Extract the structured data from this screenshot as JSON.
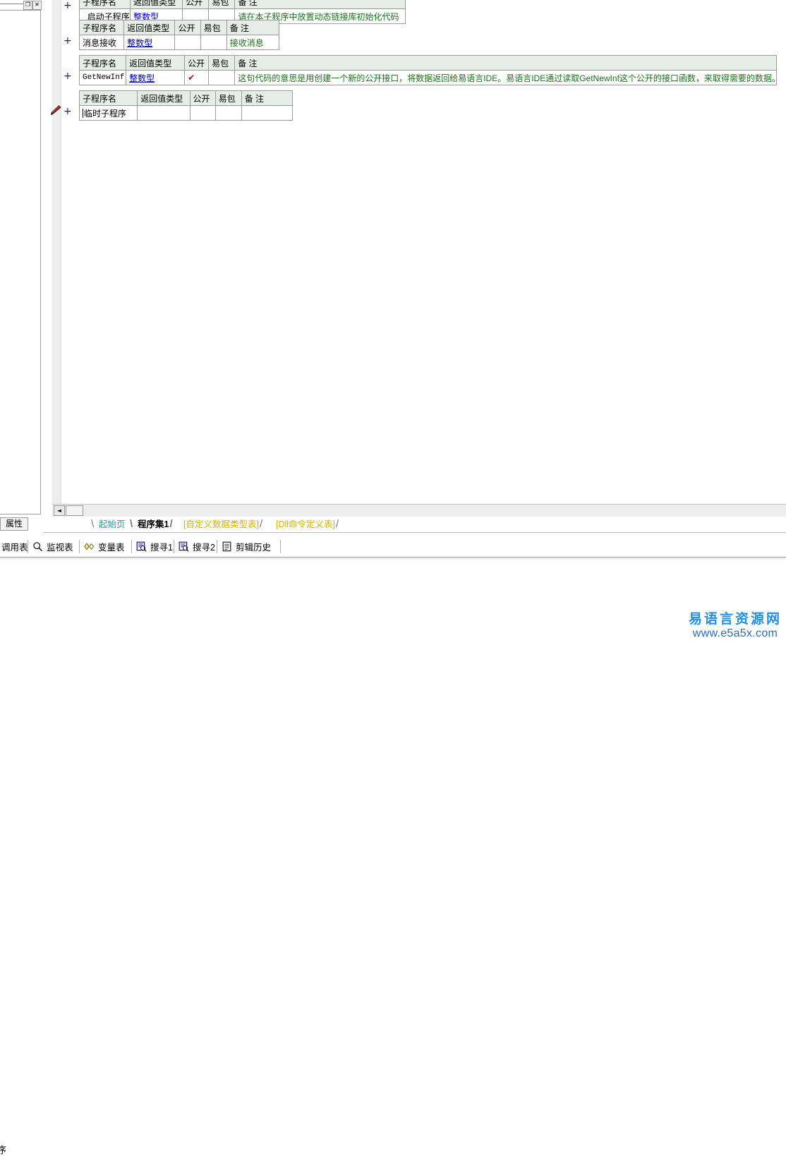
{
  "app": {
    "property_panel": {
      "tab_label": "属性",
      "maximize_glyph": "❐",
      "close_glyph": "✕"
    }
  },
  "editor": {
    "gutter": {
      "expand_glyph": "+",
      "rows_with_expander": 4,
      "pencil_icon": "pencil-icon"
    },
    "columns": [
      "子程序名",
      "返回值类型",
      "公开",
      "易包",
      "备 注"
    ],
    "tables": [
      {
        "id": "routine-table-start",
        "header_visible": false,
        "row": {
          "name": "_启动子程序",
          "return_type": "整数型",
          "public": "",
          "package": "",
          "note": "请在本子程序中放置动态链接库初始化代码"
        }
      },
      {
        "id": "routine-table-message",
        "header_visible": true,
        "row": {
          "name": "消息接收",
          "return_type": "整数型",
          "public": "",
          "package": "",
          "note": "接收消息"
        }
      },
      {
        "id": "routine-table-getnewinf",
        "header_visible": true,
        "row": {
          "name": "GetNewInf",
          "return_type": "整数型",
          "public": "✔",
          "package": "",
          "note": "这句代码的意思是用创建一个新的公开接口，将数据返回给易语言IDE。易语言IDE通过读取GetNewInf这个公开的接口函数，来取得需要的数据。"
        }
      },
      {
        "id": "routine-table-temp",
        "header_visible": true,
        "row": {
          "name": "临时子程序",
          "return_type": "",
          "public": "",
          "package": "",
          "note": ""
        }
      }
    ]
  },
  "scrollbar": {
    "left_arrow_glyph": "◄"
  },
  "doc_tabs": [
    {
      "label": "起始页",
      "color": "#22a0a0",
      "active": false
    },
    {
      "label": "程序集1",
      "color": "#000000",
      "active": true
    },
    {
      "label": "[自定义数据类型表]",
      "color": "#d9b300",
      "active": false
    },
    {
      "label": "[Dll命令定义表]",
      "color": "#d9b300",
      "active": false
    }
  ],
  "bottom_toolbar": [
    {
      "label": "调用表",
      "icon": "none"
    },
    {
      "label": "监视表",
      "icon": "magnifier-icon"
    },
    {
      "label": "变量表",
      "icon": "diamonds-icon"
    },
    {
      "label": "搜寻1",
      "icon": "find-doc-icon"
    },
    {
      "label": "搜寻2",
      "icon": "find-doc-icon"
    },
    {
      "label": "剪辑历史",
      "icon": "clipboard-list-icon"
    }
  ],
  "bottom_pane": {
    "clipped_text": "序"
  },
  "watermark": {
    "title": "易语言资源网",
    "url": "www.e5a5x.com",
    "title_color": "#1f8fe5",
    "url_color": "#2b6fb0"
  },
  "colors": {
    "header_bg": "#e6ece6",
    "type_link": "#0000bb",
    "note_green": "#197519",
    "check_red": "#8b1a1a",
    "gutter_bg": "#eeeeee"
  }
}
